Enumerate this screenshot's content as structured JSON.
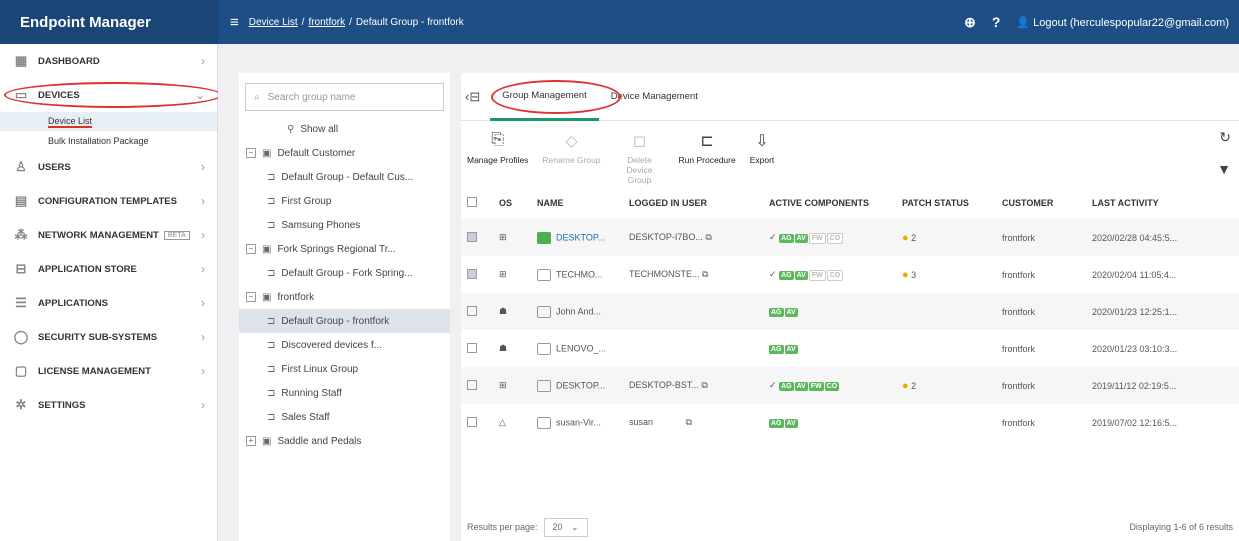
{
  "brand": "Endpoint Manager",
  "breadcrumb": {
    "menu": "≡",
    "c1": "Device List",
    "c2": "frontfork",
    "c3": "Default Group - frontfork"
  },
  "topbar": {
    "logout": "Logout (herculespopular22@gmail.com)"
  },
  "nav": {
    "dashboard": "DASHBOARD",
    "devices": "DEVICES",
    "device_list": "Device List",
    "bulk": "Bulk Installation Package",
    "users": "USERS",
    "config": "CONFIGURATION TEMPLATES",
    "network": "NETWORK MANAGEMENT",
    "beta": "BETA",
    "appstore": "APPLICATION STORE",
    "apps": "APPLICATIONS",
    "security": "SECURITY SUB-SYSTEMS",
    "license": "LICENSE MANAGEMENT",
    "settings": "SETTINGS"
  },
  "groups": {
    "placeholder": "Search group name",
    "show_all": "Show all",
    "items": [
      "Default Customer",
      "Default Group - Default Cus...",
      "First Group",
      "Samsung Phones",
      "Fork Springs Regional Tr...",
      "Default Group - Fork Spring...",
      "frontfork",
      "Default Group - frontfork",
      "Discovered devices f...",
      "First Linux Group",
      "Running Staff",
      "Sales Staff",
      "Saddle and Pedals"
    ]
  },
  "tabs": {
    "group": "Group Management",
    "device": "Device Management"
  },
  "toolbar": {
    "manage": "Manage Profiles",
    "rename": "Rename Group",
    "delete": "Delete Device Group",
    "run": "Run Procedure",
    "export": "Export"
  },
  "table": {
    "headers": {
      "os": "OS",
      "name": "NAME",
      "user": "LOGGED IN USER",
      "comp": "ACTIVE COMPONENTS",
      "patch": "PATCH STATUS",
      "cust": "CUSTOMER",
      "last": "LAST ACTIVITY"
    },
    "rows": [
      {
        "name": "DESKTOP...",
        "user": "DESKTOP-I7BO...",
        "patch": "2",
        "cust": "frontfork",
        "last": "2020/02/28 04:45:5..."
      },
      {
        "name": "TECHMO...",
        "user": "TECHMONSTE...",
        "patch": "3",
        "cust": "frontfork",
        "last": "2020/02/04 11:05:4..."
      },
      {
        "name": "John And...",
        "user": "",
        "patch": "",
        "cust": "frontfork",
        "last": "2020/01/23 12:25:1..."
      },
      {
        "name": "LENOVO_...",
        "user": "",
        "patch": "",
        "cust": "frontfork",
        "last": "2020/01/23 03:10:3..."
      },
      {
        "name": "DESKTOP...",
        "user": "DESKTOP-BST...",
        "patch": "2",
        "cust": "frontfork",
        "last": "2019/11/12 02:19:5..."
      },
      {
        "name": "susan-Vir...",
        "user": "susan",
        "patch": "",
        "cust": "frontfork",
        "last": "2019/07/02 12:16:5..."
      }
    ],
    "badges": {
      "ag": "AG",
      "av": "AV",
      "fw": "FW",
      "co": "CO"
    }
  },
  "footer": {
    "rpp": "Results per page:",
    "value": "20",
    "disp": "Displaying 1-6 of 6 results"
  }
}
